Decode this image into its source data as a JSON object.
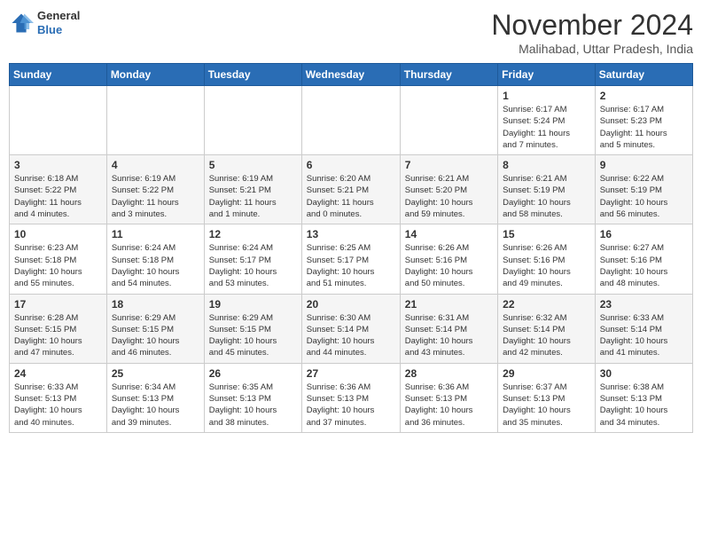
{
  "header": {
    "logo_line1": "General",
    "logo_line2": "Blue",
    "month": "November 2024",
    "location": "Malihabad, Uttar Pradesh, India"
  },
  "weekdays": [
    "Sunday",
    "Monday",
    "Tuesday",
    "Wednesday",
    "Thursday",
    "Friday",
    "Saturday"
  ],
  "weeks": [
    [
      {
        "day": "",
        "info": ""
      },
      {
        "day": "",
        "info": ""
      },
      {
        "day": "",
        "info": ""
      },
      {
        "day": "",
        "info": ""
      },
      {
        "day": "",
        "info": ""
      },
      {
        "day": "1",
        "info": "Sunrise: 6:17 AM\nSunset: 5:24 PM\nDaylight: 11 hours\nand 7 minutes."
      },
      {
        "day": "2",
        "info": "Sunrise: 6:17 AM\nSunset: 5:23 PM\nDaylight: 11 hours\nand 5 minutes."
      }
    ],
    [
      {
        "day": "3",
        "info": "Sunrise: 6:18 AM\nSunset: 5:22 PM\nDaylight: 11 hours\nand 4 minutes."
      },
      {
        "day": "4",
        "info": "Sunrise: 6:19 AM\nSunset: 5:22 PM\nDaylight: 11 hours\nand 3 minutes."
      },
      {
        "day": "5",
        "info": "Sunrise: 6:19 AM\nSunset: 5:21 PM\nDaylight: 11 hours\nand 1 minute."
      },
      {
        "day": "6",
        "info": "Sunrise: 6:20 AM\nSunset: 5:21 PM\nDaylight: 11 hours\nand 0 minutes."
      },
      {
        "day": "7",
        "info": "Sunrise: 6:21 AM\nSunset: 5:20 PM\nDaylight: 10 hours\nand 59 minutes."
      },
      {
        "day": "8",
        "info": "Sunrise: 6:21 AM\nSunset: 5:19 PM\nDaylight: 10 hours\nand 58 minutes."
      },
      {
        "day": "9",
        "info": "Sunrise: 6:22 AM\nSunset: 5:19 PM\nDaylight: 10 hours\nand 56 minutes."
      }
    ],
    [
      {
        "day": "10",
        "info": "Sunrise: 6:23 AM\nSunset: 5:18 PM\nDaylight: 10 hours\nand 55 minutes."
      },
      {
        "day": "11",
        "info": "Sunrise: 6:24 AM\nSunset: 5:18 PM\nDaylight: 10 hours\nand 54 minutes."
      },
      {
        "day": "12",
        "info": "Sunrise: 6:24 AM\nSunset: 5:17 PM\nDaylight: 10 hours\nand 53 minutes."
      },
      {
        "day": "13",
        "info": "Sunrise: 6:25 AM\nSunset: 5:17 PM\nDaylight: 10 hours\nand 51 minutes."
      },
      {
        "day": "14",
        "info": "Sunrise: 6:26 AM\nSunset: 5:16 PM\nDaylight: 10 hours\nand 50 minutes."
      },
      {
        "day": "15",
        "info": "Sunrise: 6:26 AM\nSunset: 5:16 PM\nDaylight: 10 hours\nand 49 minutes."
      },
      {
        "day": "16",
        "info": "Sunrise: 6:27 AM\nSunset: 5:16 PM\nDaylight: 10 hours\nand 48 minutes."
      }
    ],
    [
      {
        "day": "17",
        "info": "Sunrise: 6:28 AM\nSunset: 5:15 PM\nDaylight: 10 hours\nand 47 minutes."
      },
      {
        "day": "18",
        "info": "Sunrise: 6:29 AM\nSunset: 5:15 PM\nDaylight: 10 hours\nand 46 minutes."
      },
      {
        "day": "19",
        "info": "Sunrise: 6:29 AM\nSunset: 5:15 PM\nDaylight: 10 hours\nand 45 minutes."
      },
      {
        "day": "20",
        "info": "Sunrise: 6:30 AM\nSunset: 5:14 PM\nDaylight: 10 hours\nand 44 minutes."
      },
      {
        "day": "21",
        "info": "Sunrise: 6:31 AM\nSunset: 5:14 PM\nDaylight: 10 hours\nand 43 minutes."
      },
      {
        "day": "22",
        "info": "Sunrise: 6:32 AM\nSunset: 5:14 PM\nDaylight: 10 hours\nand 42 minutes."
      },
      {
        "day": "23",
        "info": "Sunrise: 6:33 AM\nSunset: 5:14 PM\nDaylight: 10 hours\nand 41 minutes."
      }
    ],
    [
      {
        "day": "24",
        "info": "Sunrise: 6:33 AM\nSunset: 5:13 PM\nDaylight: 10 hours\nand 40 minutes."
      },
      {
        "day": "25",
        "info": "Sunrise: 6:34 AM\nSunset: 5:13 PM\nDaylight: 10 hours\nand 39 minutes."
      },
      {
        "day": "26",
        "info": "Sunrise: 6:35 AM\nSunset: 5:13 PM\nDaylight: 10 hours\nand 38 minutes."
      },
      {
        "day": "27",
        "info": "Sunrise: 6:36 AM\nSunset: 5:13 PM\nDaylight: 10 hours\nand 37 minutes."
      },
      {
        "day": "28",
        "info": "Sunrise: 6:36 AM\nSunset: 5:13 PM\nDaylight: 10 hours\nand 36 minutes."
      },
      {
        "day": "29",
        "info": "Sunrise: 6:37 AM\nSunset: 5:13 PM\nDaylight: 10 hours\nand 35 minutes."
      },
      {
        "day": "30",
        "info": "Sunrise: 6:38 AM\nSunset: 5:13 PM\nDaylight: 10 hours\nand 34 minutes."
      }
    ]
  ]
}
